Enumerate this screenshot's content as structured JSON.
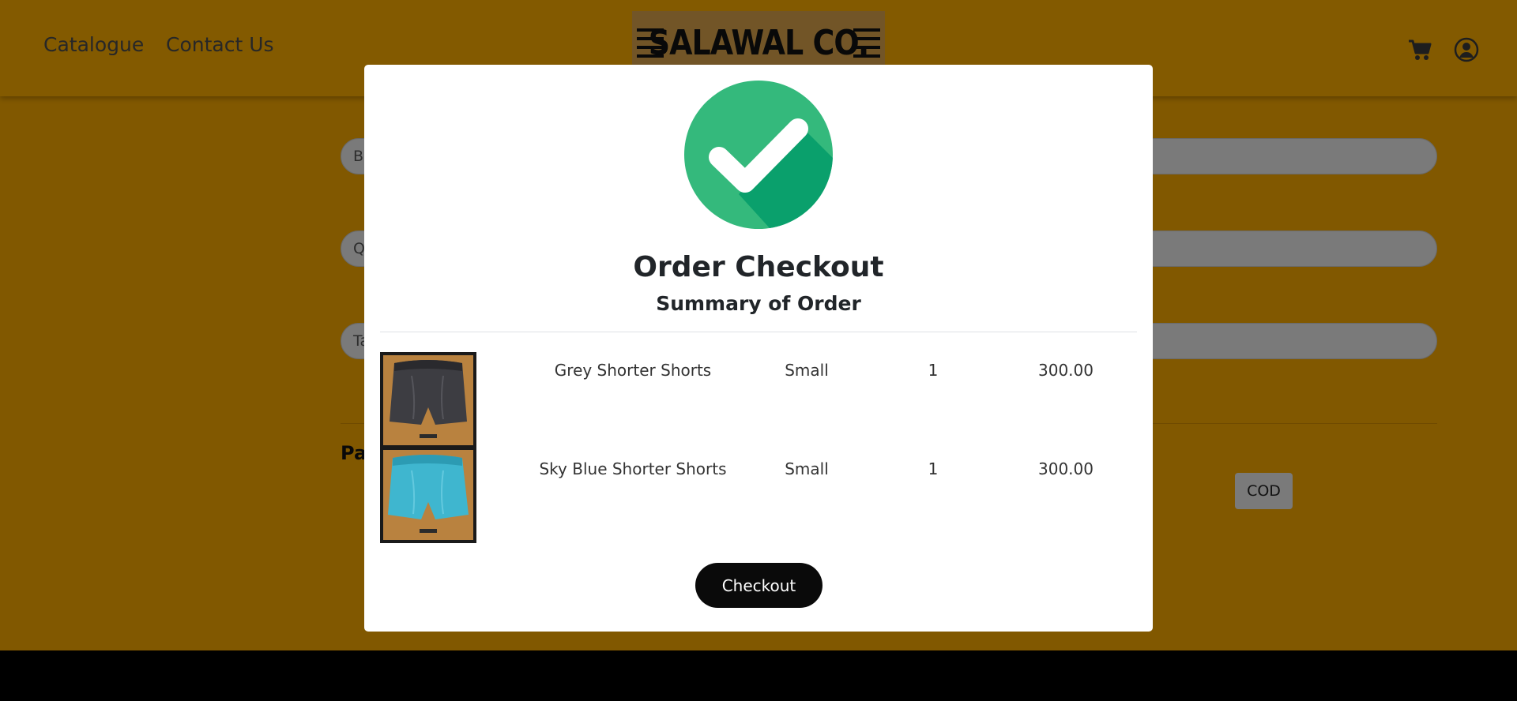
{
  "nav": {
    "catalogue": "Catalogue",
    "contact": "Contact Us"
  },
  "brand": {
    "logo_text": "SALAWAL CO."
  },
  "icons": {
    "cart": "cart-icon",
    "account": "user-circle-icon",
    "success": "check-circle-icon"
  },
  "background_form": {
    "field1_hint": "B",
    "field2_hint": "Q",
    "field3_hint": "Ta",
    "payment_label": "Pay",
    "cod_label": "COD"
  },
  "modal": {
    "title": "Order Checkout",
    "subtitle": "Summary of Order",
    "checkout_label": "Checkout",
    "items": [
      {
        "name": "Grey Shorter Shorts",
        "size": "Small",
        "qty": "1",
        "price": "300.00"
      },
      {
        "name": "Sky Blue Shorter Shorts",
        "size": "Small",
        "qty": "1",
        "price": "300.00"
      }
    ]
  },
  "colors": {
    "page_bg": "#f3a600",
    "check_green": "#34b97c",
    "check_dark_green": "#0aa06c",
    "button_bg": "#0a0a0a"
  }
}
